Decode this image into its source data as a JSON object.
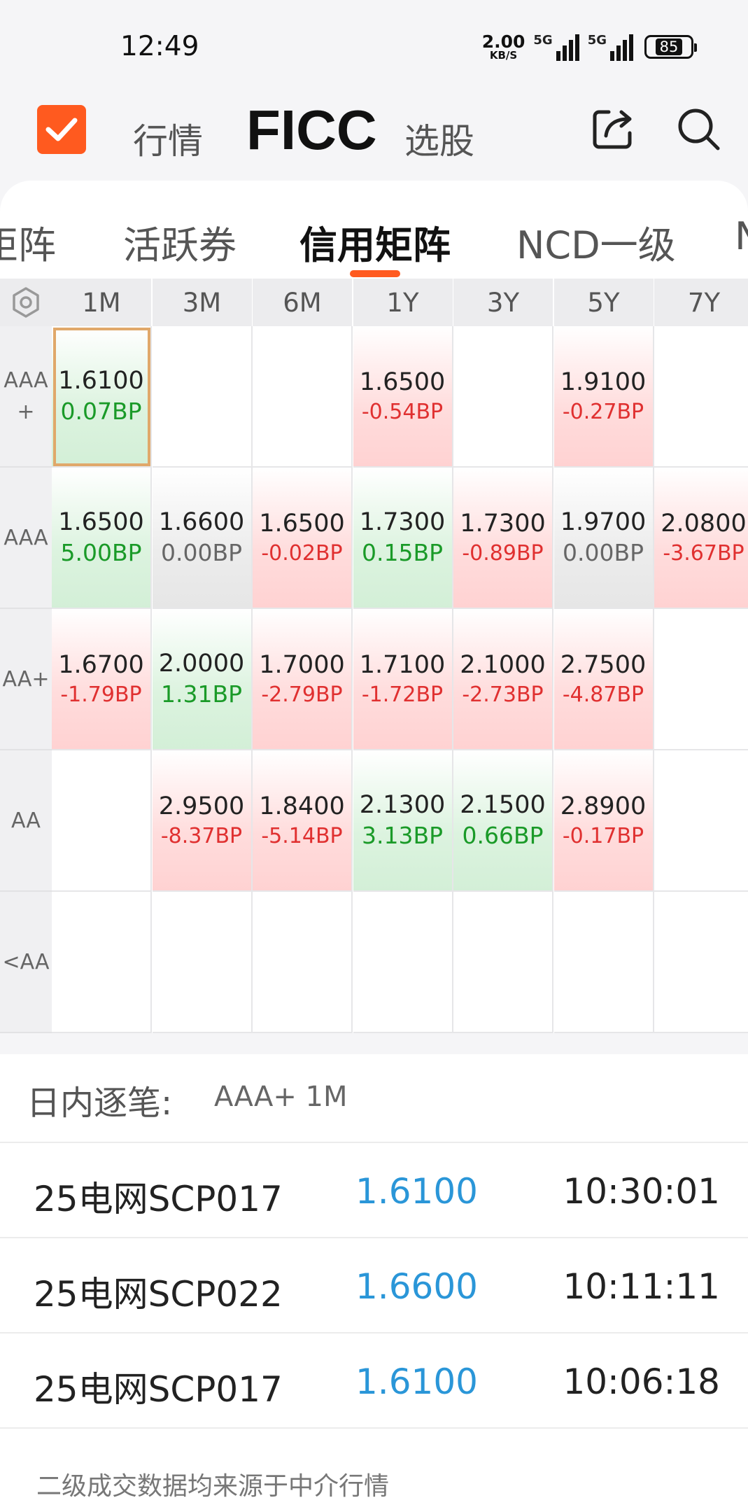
{
  "status_bar": {
    "time": "12:49",
    "net_speed_value": "2.00",
    "net_speed_unit": "KB/S",
    "sim1": "5G",
    "sim2": "5G",
    "battery": "85"
  },
  "nav": {
    "tabs": [
      "行情",
      "FICC",
      "选股"
    ],
    "active_tab": "FICC",
    "logo_icon": "check-logo-icon",
    "right_icons": [
      "share-icon",
      "search-icon"
    ]
  },
  "sub_tabs": {
    "items": [
      "矩阵",
      "活跃券",
      "信用矩阵",
      "NCD一级",
      "N"
    ],
    "active": "信用矩阵"
  },
  "matrix": {
    "terms": [
      "1M",
      "3M",
      "6M",
      "1Y",
      "3Y",
      "5Y",
      "7Y"
    ],
    "rows": [
      {
        "label": "AAA +",
        "cells": [
          {
            "rate": "1.6100",
            "chg": "0.07BP",
            "dir": "down",
            "selected": true
          },
          null,
          null,
          {
            "rate": "1.6500",
            "chg": "-0.54BP",
            "dir": "up"
          },
          null,
          {
            "rate": "1.9100",
            "chg": "-0.27BP",
            "dir": "up"
          },
          null
        ]
      },
      {
        "label": "AAA",
        "cells": [
          {
            "rate": "1.6500",
            "chg": "5.00BP",
            "dir": "down"
          },
          {
            "rate": "1.6600",
            "chg": "0.00BP",
            "dir": "flat"
          },
          {
            "rate": "1.6500",
            "chg": "-0.02BP",
            "dir": "up"
          },
          {
            "rate": "1.7300",
            "chg": "0.15BP",
            "dir": "down"
          },
          {
            "rate": "1.7300",
            "chg": "-0.89BP",
            "dir": "up"
          },
          {
            "rate": "1.9700",
            "chg": "0.00BP",
            "dir": "flat"
          },
          {
            "rate": "2.0800",
            "chg": "-3.67BP",
            "dir": "up"
          }
        ]
      },
      {
        "label": "AA+",
        "cells": [
          {
            "rate": "1.6700",
            "chg": "-1.79BP",
            "dir": "up"
          },
          {
            "rate": "2.0000",
            "chg": "1.31BP",
            "dir": "down"
          },
          {
            "rate": "1.7000",
            "chg": "-2.79BP",
            "dir": "up"
          },
          {
            "rate": "1.7100",
            "chg": "-1.72BP",
            "dir": "up"
          },
          {
            "rate": "2.1000",
            "chg": "-2.73BP",
            "dir": "up"
          },
          {
            "rate": "2.7500",
            "chg": "-4.87BP",
            "dir": "up"
          },
          null
        ]
      },
      {
        "label": "AA",
        "cells": [
          null,
          {
            "rate": "2.9500",
            "chg": "-8.37BP",
            "dir": "up"
          },
          {
            "rate": "1.8400",
            "chg": "-5.14BP",
            "dir": "up"
          },
          {
            "rate": "2.1300",
            "chg": "3.13BP",
            "dir": "down"
          },
          {
            "rate": "2.1500",
            "chg": "0.66BP",
            "dir": "down"
          },
          {
            "rate": "2.8900",
            "chg": "-0.17BP",
            "dir": "up"
          },
          null
        ]
      },
      {
        "label": "<AA",
        "cells": [
          null,
          null,
          null,
          null,
          null,
          null,
          null
        ]
      }
    ]
  },
  "intraday": {
    "title": "日内逐笔:",
    "selection": "AAA+ 1M",
    "trades": [
      {
        "name": "25电网SCP017",
        "price": "1.6100",
        "time": "10:30:01"
      },
      {
        "name": "25电网SCP022",
        "price": "1.6600",
        "time": "10:11:11"
      },
      {
        "name": "25电网SCP017",
        "price": "1.6100",
        "time": "10:06:18"
      }
    ]
  },
  "footnote": "二级成交数据均来源于中介行情",
  "colors": {
    "accent": "#ff5a1f",
    "rise_red": "#e03030",
    "fall_green": "#1a9a28",
    "price_blue": "#2a96d8"
  }
}
